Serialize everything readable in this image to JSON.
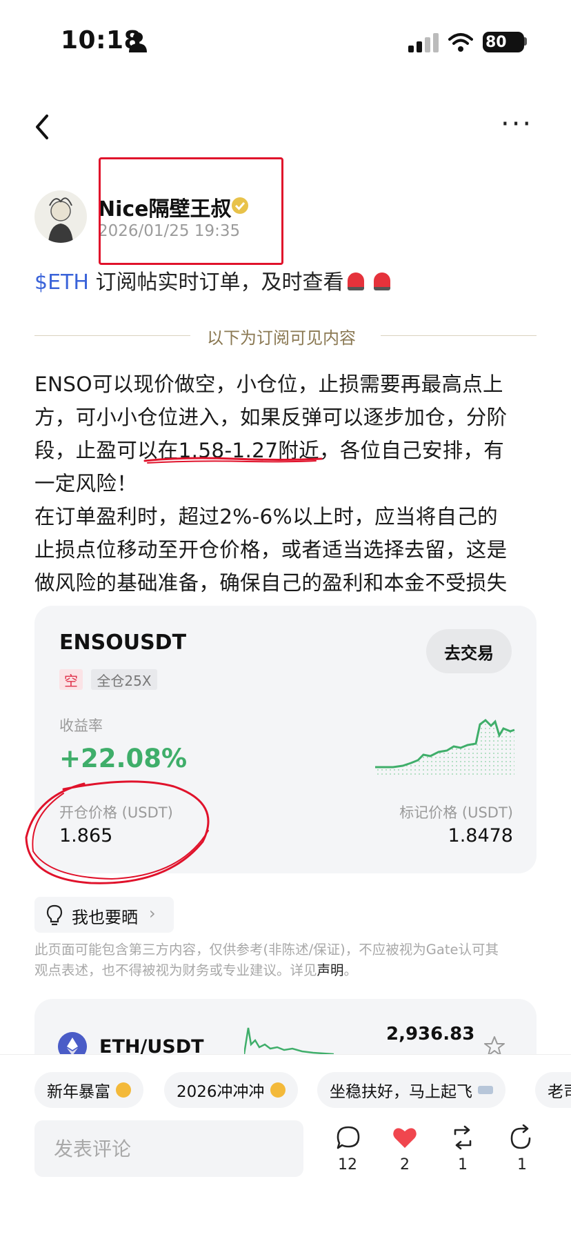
{
  "status_bar": {
    "time": "10:18",
    "battery": "80"
  },
  "author": {
    "name": "Nice隔壁王叔",
    "post_time": "2026/01/25 19:35"
  },
  "post": {
    "tag": "$ETH",
    "intro": " 订阅帖实时订单，及时查看",
    "divider_label": "以下为订阅可见内容",
    "lines": [
      "ENSO可以现价做空，小仓位，止损需要再最高点上",
      "方，可小小仓位进入，如果反弹可以逐步加仓，分阶",
      "段，止盈可以在1.58-1.27附近，各位自己安排，有",
      "一定风险！",
      "在订单盈利时，超过2%-6%以上时，应当将自己的",
      "止损点位移动至开仓价格，或者适当选择去留，这是",
      "做风险的基础准备，确保自己的盈利和本金不受损失"
    ]
  },
  "trade_card": {
    "pair": "ENSOUSDT",
    "trade_button": "去交易",
    "side": "空",
    "mode": "全仓25X",
    "roi_label": "收益率",
    "roi_value": "+22.08%",
    "entry_label": "开仓价格 (USDT)",
    "entry_value": "1.865",
    "mark_label": "标记价格 (USDT)",
    "mark_value": "1.8478",
    "accent_color": "#3fae6a"
  },
  "share": {
    "label": "我也要晒"
  },
  "disclaimer": {
    "line1": "此页面可能包含第三方内容，仅供参考(非陈述/保证)，不应被视为Gate认可其",
    "line2": "观点表述，也不得被视为财务或专业建议。详见",
    "link": "声明",
    "end": "。"
  },
  "market_card": {
    "pair": "ETH/USDT",
    "price": "2,936.83"
  },
  "chips": [
    "新年暴富",
    "2026冲冲冲",
    "坐稳扶好，马上起飞",
    "老司"
  ],
  "comment": {
    "placeholder": "发表评论"
  },
  "actions": {
    "comments": "12",
    "likes": "2",
    "reposts": "1",
    "shares": "1"
  }
}
